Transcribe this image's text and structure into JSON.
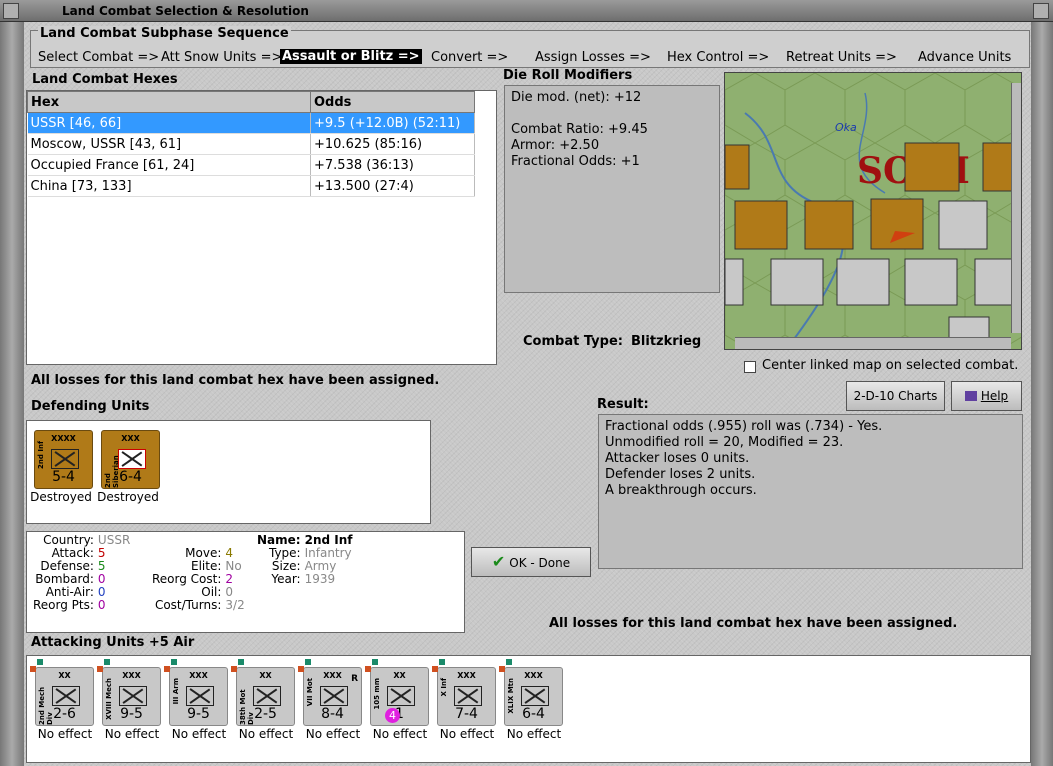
{
  "window": {
    "title": "Land Combat Selection & Resolution"
  },
  "sequence": {
    "title": "Land Combat Subphase Sequence",
    "items": [
      "Select Combat =>",
      "Att Snow Units =>",
      "Assault or Blitz =>",
      "Convert =>",
      "Assign Losses =>",
      "Hex Control =>",
      "Retreat Units =>",
      "Advance Units"
    ],
    "selected_index": 2
  },
  "hexes": {
    "title": "Land Combat Hexes",
    "headers": [
      "Hex",
      "Odds"
    ],
    "rows": [
      [
        "USSR [46, 66]",
        "+9.5 (+12.0B) (52:11)"
      ],
      [
        "Moscow, USSR [43, 61]",
        "+10.625 (85:16)"
      ],
      [
        "Occupied France [61, 24]",
        "+7.538 (36:13)"
      ],
      [
        "China [73, 133]",
        "+13.500 (27:4)"
      ]
    ],
    "selected_row": 0
  },
  "modifiers": {
    "title": "Die Roll Modifiers",
    "lines": [
      "Die mod. (net): +12",
      "",
      "Combat Ratio: +9.45",
      "Armor: +2.50",
      "Fractional Odds: +1"
    ]
  },
  "combat_type": {
    "label": "Combat Type:",
    "value": "Blitzkrieg"
  },
  "losses_msg": "All losses for this land combat hex have been assigned.",
  "center_map": {
    "label": "Center linked map on selected combat.",
    "checked": false
  },
  "buttons": {
    "charts": "2-D-10 Charts",
    "help": "Help",
    "done": "OK - Done"
  },
  "result": {
    "title": "Result:",
    "lines": [
      "Fractional odds (.955) roll was (.734)  - Yes.",
      "Unmodified roll = 20, Modified = 23.",
      "Attacker loses 0 units.",
      "Defender loses 2 units.",
      "A breakthrough occurs."
    ]
  },
  "defending": {
    "title": "Defending Units",
    "units": [
      {
        "name": "2nd Inf",
        "size": "XXXX",
        "value": "5-4",
        "status": "Destroyed"
      },
      {
        "name": "2nd Siberian",
        "size": "XXX",
        "value": "6-4",
        "status": "Destroyed"
      }
    ]
  },
  "details": {
    "country_label": "Country:",
    "country": "USSR",
    "attack_label": "Attack:",
    "attack": "5",
    "defense_label": "Defense:",
    "defense": "5",
    "bombard_label": "Bombard:",
    "bombard": "0",
    "antiair_label": "Anti-Air:",
    "antiair": "0",
    "reorg_label": "Reorg Pts:",
    "reorg": "0",
    "move_label": "Move:",
    "move": "4",
    "elite_label": "Elite:",
    "elite": "No",
    "reorgcost_label": "Reorg Cost:",
    "reorgcost": "2",
    "oil_label": "Oil:",
    "oil": "0",
    "costturns_label": "Cost/Turns:",
    "costturns": "3/2",
    "name_label": "Name:",
    "name": "2nd Inf",
    "type_label": "Type:",
    "type": "Infantry",
    "size_label": "Size:",
    "size": "Army",
    "year_label": "Year:",
    "year": "1939"
  },
  "attacking": {
    "title": "Attacking Units +5 Air",
    "units": [
      {
        "name": "2nd Mech Div",
        "size": "XX",
        "value": "2-6",
        "status": "No effect"
      },
      {
        "name": "XVIII Mech",
        "size": "XXX",
        "value": "9-5",
        "status": "No effect"
      },
      {
        "name": "III Arm",
        "size": "XXX",
        "value": "9-5",
        "status": "No effect"
      },
      {
        "name": "38th Mot Div",
        "size": "XX",
        "value": "2-5",
        "status": "No effect"
      },
      {
        "name": "VII Mot",
        "size": "XXX",
        "value": "8-4",
        "status": "No effect",
        "tag": "R"
      },
      {
        "name": "105 mm",
        "size": "XX",
        "value": "1",
        "badge": "4",
        "status": "No effect"
      },
      {
        "name": "X Inf",
        "size": "XXX",
        "value": "7-4",
        "status": "No effect"
      },
      {
        "name": "XLIX Mtn",
        "size": "XXX",
        "value": "6-4",
        "status": "No effect"
      }
    ]
  },
  "map": {
    "river": "Oka",
    "region": "SO",
    "region2": "I"
  },
  "colors": {
    "selection": "#3399ff",
    "soviet_counter": "#b07a18",
    "german_counter": "#c8c8c8",
    "red_value": "#c00000",
    "green_value": "#1a8a1a",
    "purple_value": "#a000a0",
    "gold_value": "#8a7a00"
  }
}
